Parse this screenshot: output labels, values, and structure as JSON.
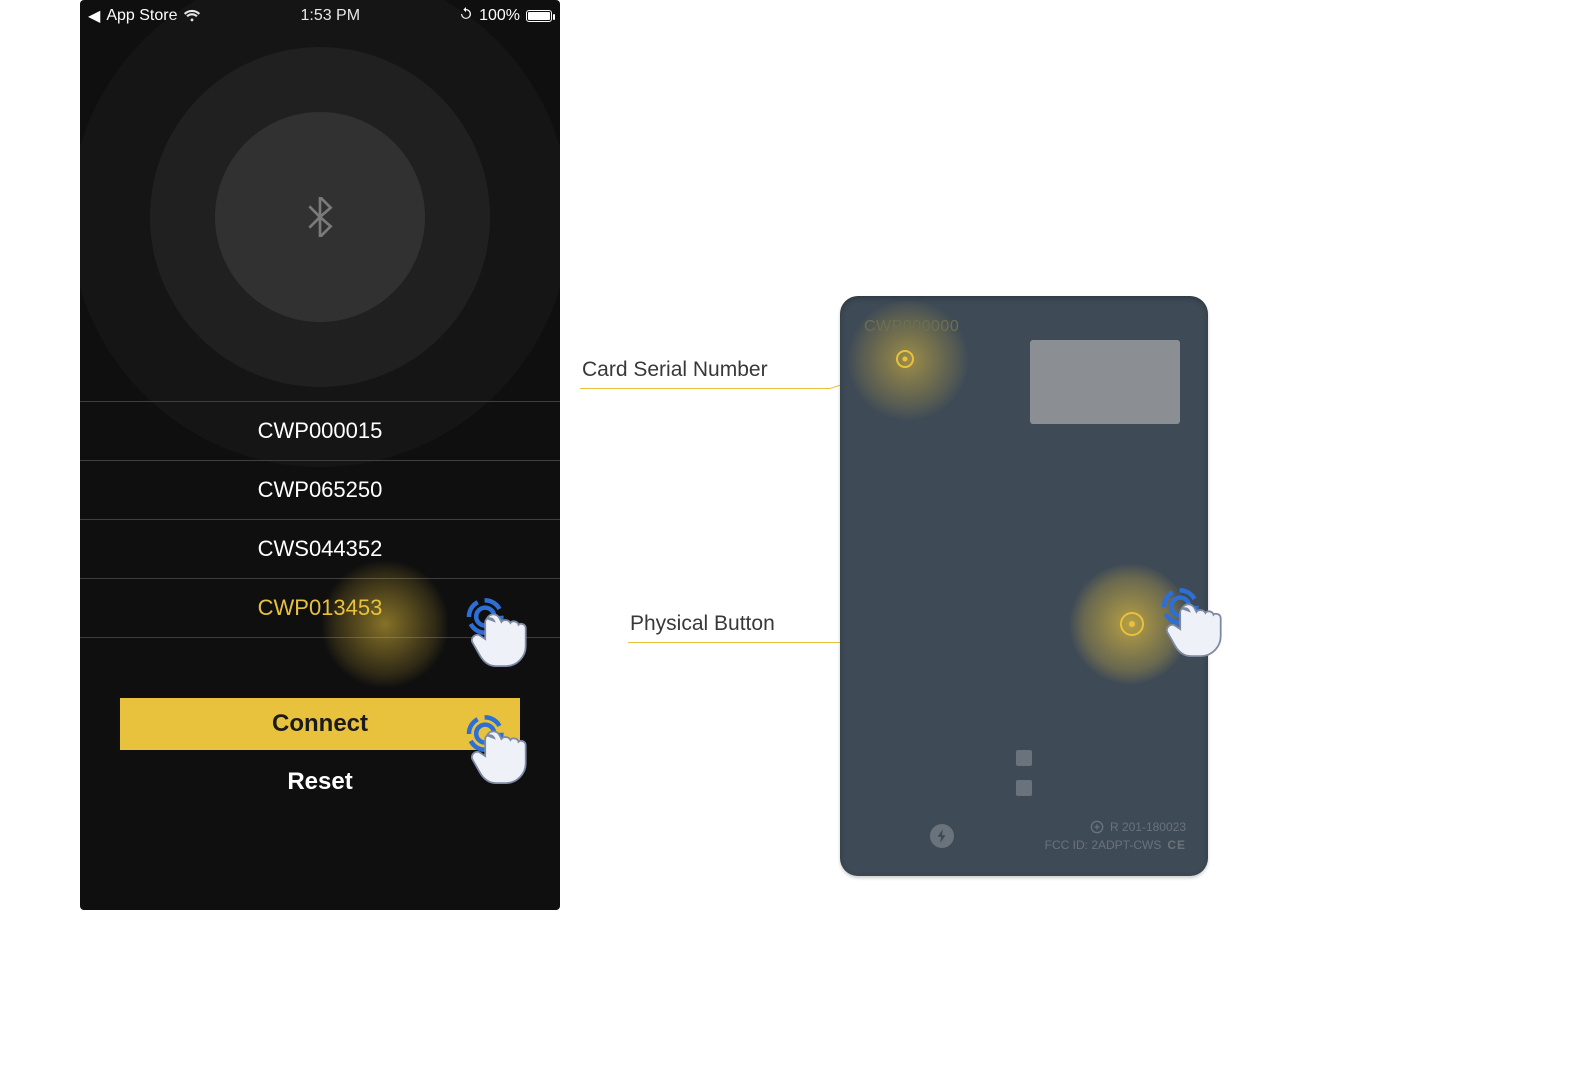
{
  "status_bar": {
    "back_label": "App Store",
    "time": "1:53 PM",
    "battery_pct": "100%"
  },
  "devices": [
    {
      "id": "CWP000015",
      "selected": false
    },
    {
      "id": "CWP065250",
      "selected": false
    },
    {
      "id": "CWS044352",
      "selected": false
    },
    {
      "id": "CWP013453",
      "selected": true
    }
  ],
  "buttons": {
    "connect": "Connect",
    "reset": "Reset"
  },
  "card": {
    "serial_sample": "CWP000000",
    "cert_line1": "R  201-180023",
    "cert_line2_left": "FCC ID: 2ADPT-CWS",
    "cert_ce": "CE"
  },
  "callouts": {
    "serial": "Card Serial Number",
    "physical_button": "Physical Button"
  }
}
